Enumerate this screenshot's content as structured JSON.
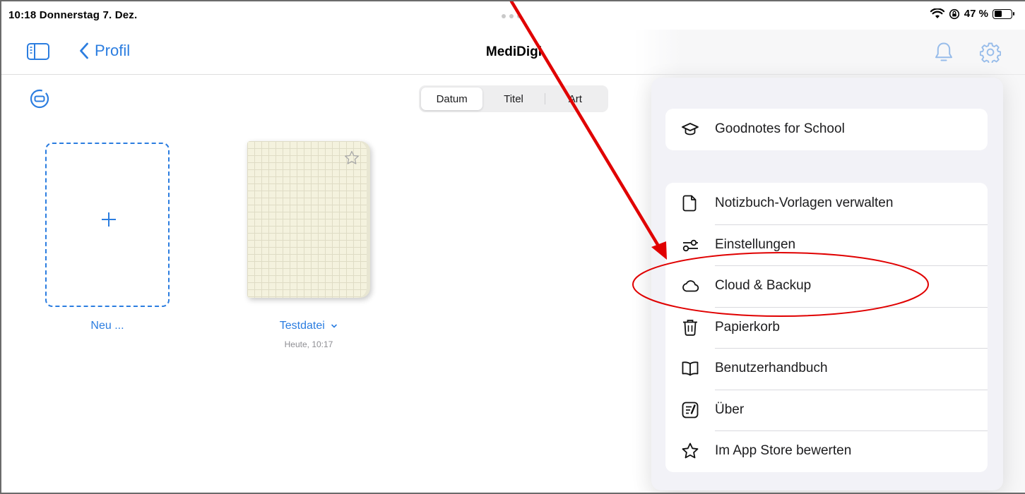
{
  "status": {
    "time_date": "10:18  Donnerstag 7. Dez.",
    "battery": "47 %",
    "battery_level": 0.47
  },
  "nav": {
    "back_label": "Profil",
    "title": "MediDigi"
  },
  "sort": {
    "options": [
      "Datum",
      "Titel",
      "Art"
    ],
    "selected": "Datum"
  },
  "library": {
    "new_label": "Neu ...",
    "notebook_title": "Testdatei",
    "notebook_date": "Heute, 10:17"
  },
  "menu": {
    "group1": [
      {
        "label": "Goodnotes for School",
        "icon": "graduation-cap-icon"
      }
    ],
    "group2": [
      {
        "label": "Notizbuch-Vorlagen verwalten",
        "icon": "document-icon"
      },
      {
        "label": "Einstellungen",
        "icon": "sliders-icon"
      },
      {
        "label": "Cloud & Backup",
        "icon": "cloud-icon"
      },
      {
        "label": "Papierkorb",
        "icon": "trash-icon"
      },
      {
        "label": "Benutzerhandbuch",
        "icon": "book-icon"
      },
      {
        "label": "Über",
        "icon": "info-note-icon"
      },
      {
        "label": "Im App Store bewerten",
        "icon": "star-icon"
      }
    ]
  },
  "colors": {
    "accent": "#2b7de0",
    "annotation": "#e00000"
  }
}
